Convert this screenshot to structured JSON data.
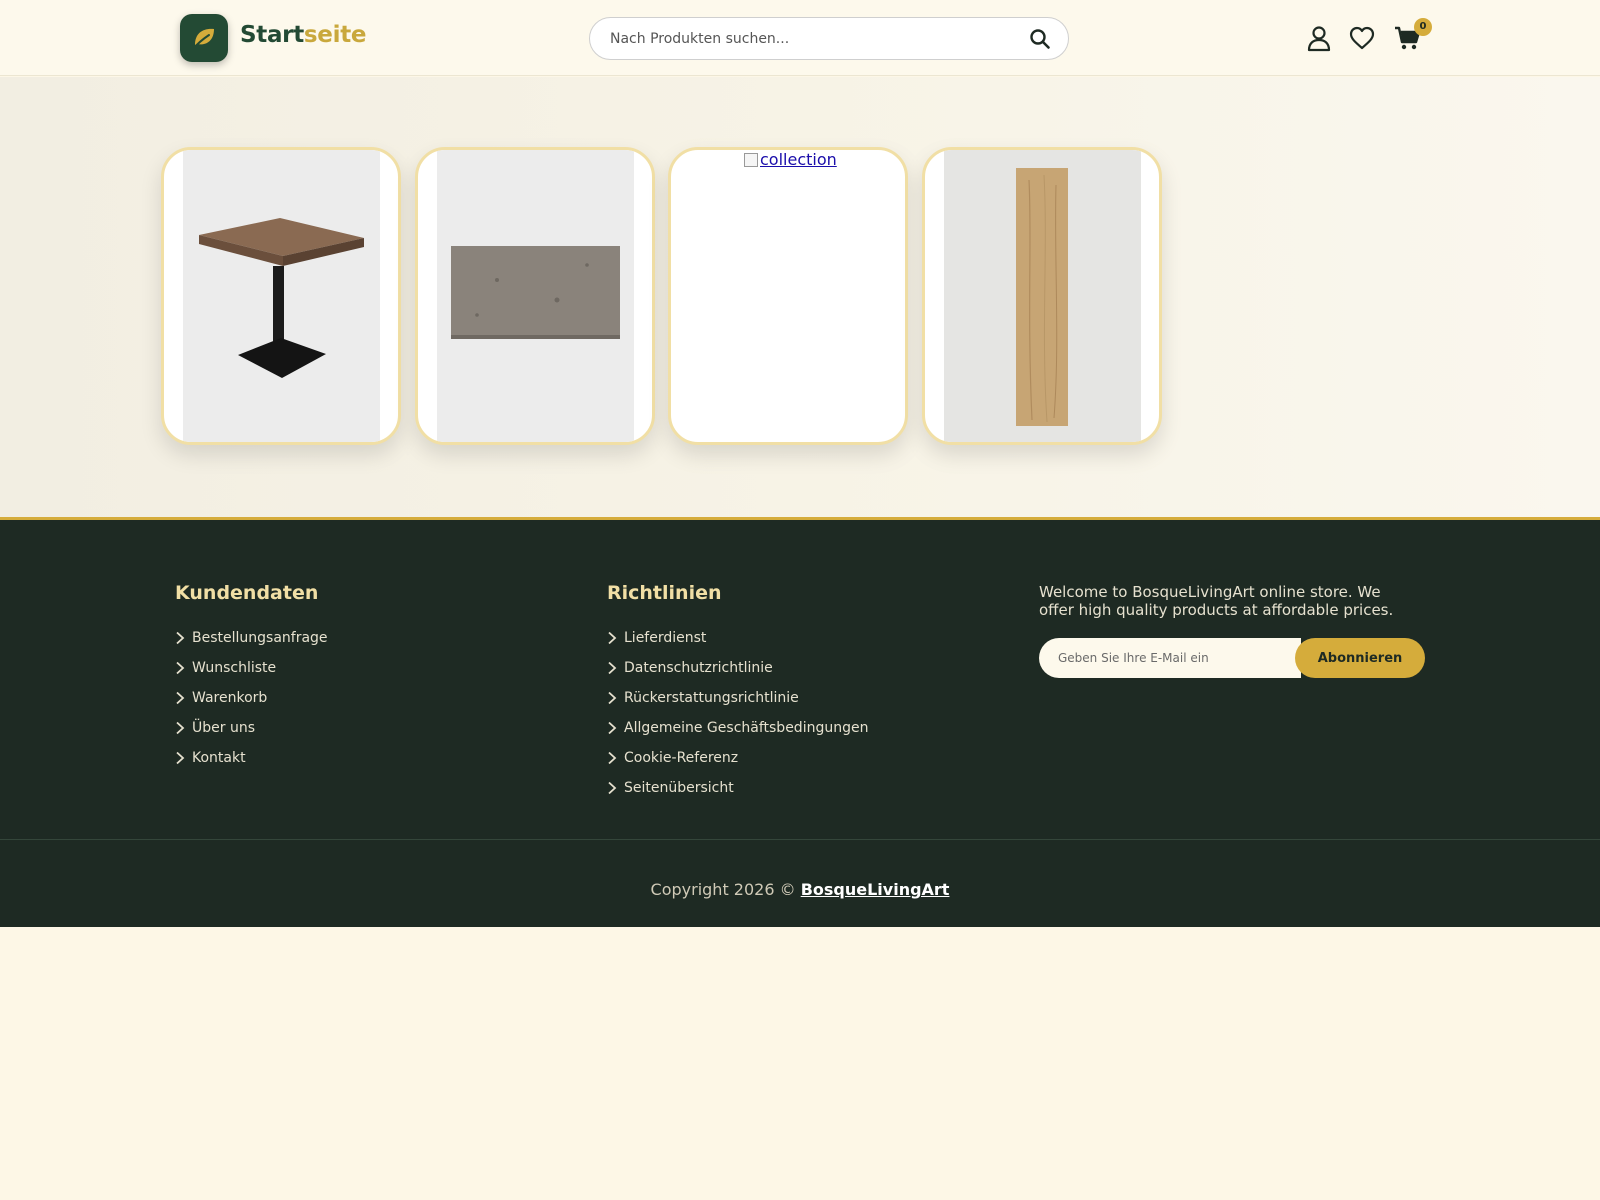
{
  "header": {
    "logo_word_1": "Start",
    "logo_word_2": "seite",
    "search_placeholder": "Nach Produkten suchen...",
    "cart_count": "0",
    "icons": [
      "leaf-logo-icon",
      "search-icon",
      "user-icon",
      "heart-icon",
      "cart-icon"
    ]
  },
  "collections": [
    {
      "image": "wooden-table-icon"
    },
    {
      "image": "stone-slab-icon"
    },
    {
      "image_alt": "collection"
    },
    {
      "image": "wood-plank-icon"
    }
  ],
  "footer": {
    "customer": {
      "title": "Kundendaten",
      "links": [
        "Bestellungsanfrage",
        "Wunschliste",
        "Warenkorb",
        "Über uns",
        "Kontakt"
      ]
    },
    "policies": {
      "title": "Richtlinien",
      "links": [
        "Lieferdienst",
        "Datenschutzrichtlinie",
        "Rückerstattungsrichtlinie",
        "Allgemeine Geschäftsbedingungen",
        "Cookie-Referenz",
        "Seitenübersicht"
      ]
    },
    "newsletter": {
      "welcome": "Welcome to BosqueLivingArt online store. We offer high quality products at affordable prices.",
      "email_placeholder": "Geben Sie Ihre E-Mail ein",
      "button": "Abonnieren"
    },
    "copyright_prefix": "Copyright 2026 © ",
    "brand": "BosqueLivingArt"
  },
  "colors": {
    "brand_green": "#234a34",
    "accent_gold": "#d5ac3b",
    "footer_bg": "#1e2a23",
    "card_border": "#f1dfa5",
    "page_bg": "#fdf7e6"
  }
}
